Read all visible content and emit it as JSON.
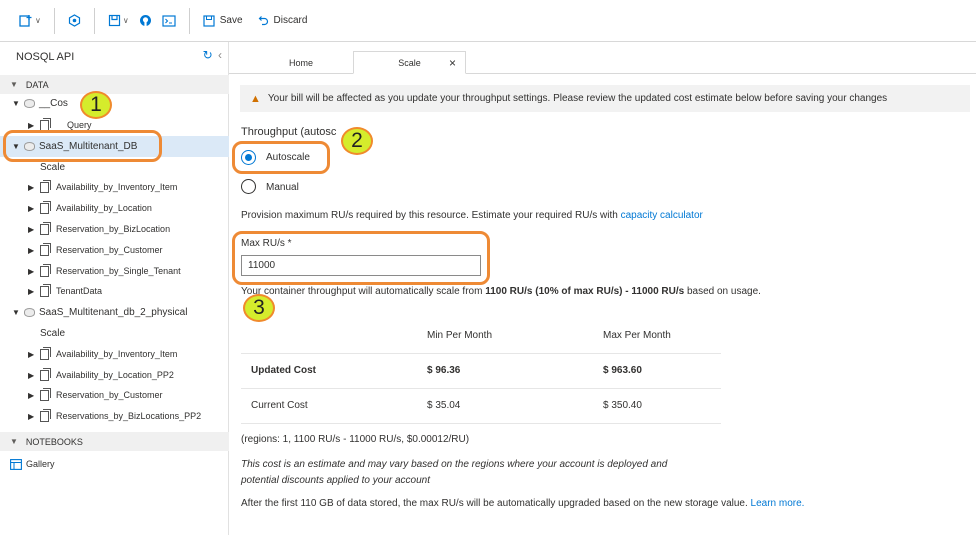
{
  "toolbar": {
    "save_label": "Save",
    "discard_label": "Discard"
  },
  "sidebar": {
    "title": "NOSQL API",
    "data_section": "DATA",
    "notebooks_section": "NOTEBOOKS",
    "db1": {
      "name": "__Cos",
      "child": "Query"
    },
    "db2": {
      "name": "SaaS_Multitenant_DB",
      "scale": "Scale",
      "collections": [
        "Availability_by_Inventory_Item",
        "Availability_by_Location",
        "Reservation_by_BizLocation",
        "Reservation_by_Customer",
        "Reservation_by_Single_Tenant",
        "TenantData"
      ]
    },
    "db3": {
      "name": "SaaS_Multitenant_db_2_physical",
      "scale": "Scale",
      "collections": [
        "Availability_by_Inventory_Item",
        "Availability_by_Location_PP2",
        "Reservation_by_Customer",
        "Reservations_by_BizLocations_PP2"
      ]
    },
    "gallery": "Gallery"
  },
  "tabs": {
    "home": "Home",
    "scale": "Scale",
    "close": "×"
  },
  "main": {
    "warning": "Your bill will be affected as you update your throughput settings. Please review the updated cost estimate below before saving your changes",
    "throughput_label": "Throughput (autosc",
    "autoscale": "Autoscale",
    "manual": "Manual",
    "provision_text": "Provision maximum RU/s required by this resource. Estimate your required RU/s with ",
    "capacity_link": "capacity calculator",
    "max_ru_label": "Max RU/s *",
    "max_ru_value": "11000",
    "scale_text_1": "Your container throughput will automatically scale from ",
    "scale_text_bold": "1100 RU/s (10% of max RU/s) - 11000 RU/s",
    "scale_text_2": " based on usage.",
    "cost_headers": [
      "Min Per Month",
      "Max Per Month"
    ],
    "updated_cost": {
      "label": "Updated Cost",
      "min": "$ 96.36",
      "max": "$ 963.60"
    },
    "current_cost": {
      "label": "Current Cost",
      "min": "$ 35.04",
      "max": "$ 350.40"
    },
    "regions_text": "(regions: 1, 1100 RU/s - 11000 RU/s, $0.00012/RU)",
    "estimate_line1": "This cost is an estimate and may vary based on the regions where your account is deployed and",
    "estimate_line2": "potential discounts applied to your account",
    "upgrade_text": "After the first 110 GB of data stored, the max RU/s will be automatically upgraded based on the new storage value. ",
    "learn_more": "Learn more."
  },
  "annotations": [
    "1",
    "2",
    "3"
  ],
  "colors": {
    "accent": "#0078d4",
    "annotation_ring": "#ee8a35",
    "badge_fill": "#d5ec2c"
  }
}
